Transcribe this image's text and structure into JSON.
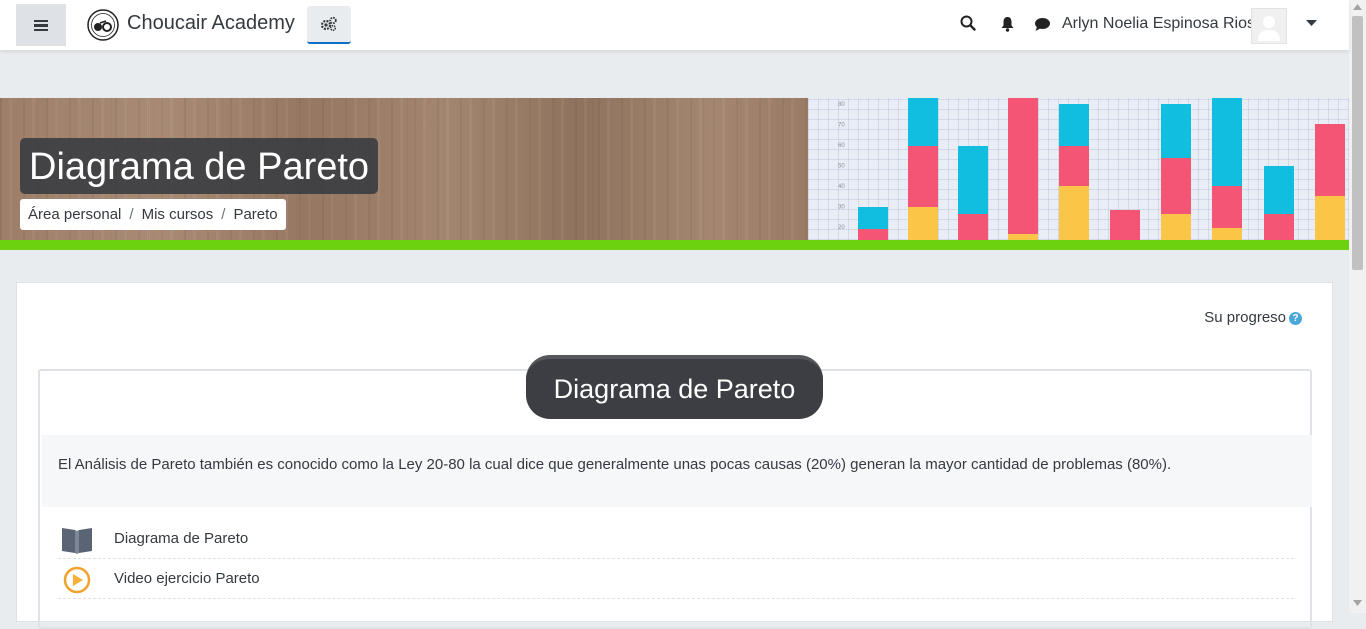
{
  "navbar": {
    "brand": "Choucair Academy",
    "user_name": "Arlyn Noelia Espinosa Rios",
    "icons": [
      "hamburger-icon",
      "logo-icon",
      "gear-icon",
      "search-icon",
      "bell-icon",
      "chat-icon",
      "caret-down-icon"
    ]
  },
  "header": {
    "title": "Diagrama de Pareto",
    "breadcrumb": [
      "Área personal",
      "Mis cursos",
      "Pareto"
    ],
    "accent_color": "#6cd20f"
  },
  "banner_chart": {
    "ytick_labels": [
      "80",
      "70",
      "60",
      "50",
      "40",
      "30",
      "20"
    ]
  },
  "content": {
    "progress_label": "Su progreso",
    "help_glyph": "?",
    "section": {
      "title": "Diagrama de Pareto",
      "summary": "El Análisis de Pareto también es conocido como la Ley 20-80 la cual dice que generalmente unas pocas causas (20%) generan la mayor cantidad de problemas (80%).",
      "activities": [
        {
          "name": "Diagrama de Pareto",
          "icon": "book-icon"
        },
        {
          "name": "Video ejercicio Pareto",
          "icon": "play-circle-icon"
        }
      ]
    }
  }
}
